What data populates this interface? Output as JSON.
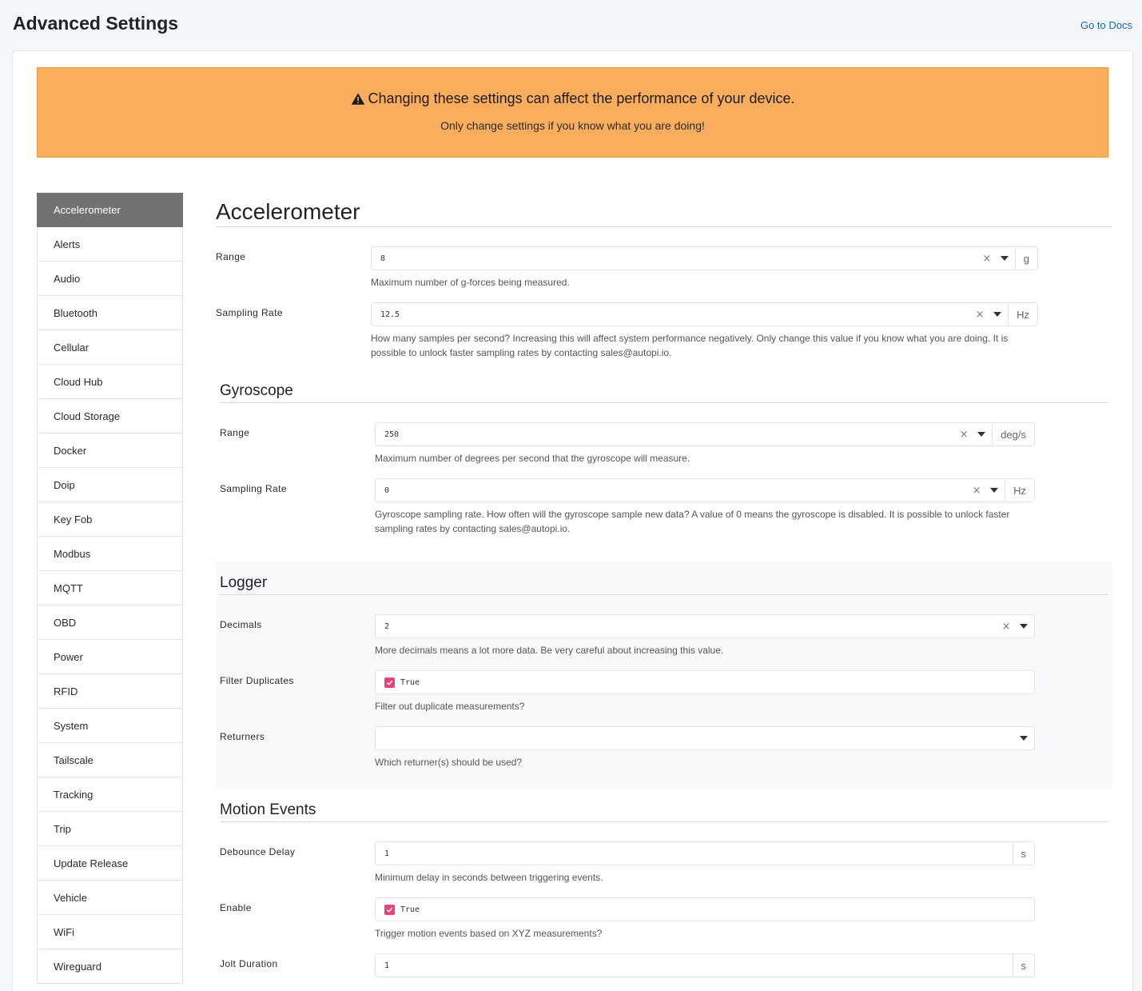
{
  "page": {
    "title": "Advanced Settings",
    "docs_link": "Go to Docs"
  },
  "warning": {
    "title": "Changing these settings can affect the performance of your device.",
    "subtitle": "Only change settings if you know what you are doing!"
  },
  "sidebar": {
    "items": [
      {
        "label": "Accelerometer",
        "active": true
      },
      {
        "label": "Alerts"
      },
      {
        "label": "Audio"
      },
      {
        "label": "Bluetooth"
      },
      {
        "label": "Cellular"
      },
      {
        "label": "Cloud Hub"
      },
      {
        "label": "Cloud Storage"
      },
      {
        "label": "Docker"
      },
      {
        "label": "Doip"
      },
      {
        "label": "Key Fob"
      },
      {
        "label": "Modbus"
      },
      {
        "label": "MQTT"
      },
      {
        "label": "OBD"
      },
      {
        "label": "Power"
      },
      {
        "label": "RFID"
      },
      {
        "label": "System"
      },
      {
        "label": "Tailscale"
      },
      {
        "label": "Tracking"
      },
      {
        "label": "Trip"
      },
      {
        "label": "Update Release"
      },
      {
        "label": "Vehicle"
      },
      {
        "label": "WiFi"
      },
      {
        "label": "Wireguard"
      }
    ]
  },
  "accelerometer": {
    "heading": "Accelerometer",
    "range": {
      "label": "Range",
      "value": "8",
      "unit": "g",
      "help": "Maximum number of g-forces being measured."
    },
    "sampling_rate": {
      "label": "Sampling Rate",
      "value": "12.5",
      "unit": "Hz",
      "help": "How many samples per second? Increasing this will affect system performance negatively. Only change this value if you know what you are doing. It is possible to unlock faster sampling rates by contacting sales@autopi.io."
    }
  },
  "gyroscope": {
    "heading": "Gyroscope",
    "range": {
      "label": "Range",
      "value": "250",
      "unit": "deg/s",
      "help": "Maximum number of degrees per second that the gyroscope will measure."
    },
    "sampling_rate": {
      "label": "Sampling Rate",
      "value": "0",
      "unit": "Hz",
      "help": "Gyroscope sampling rate. How often will the gyroscope sample new data? A value of 0 means the gyroscope is disabled. It is possible to unlock faster sampling rates by contacting sales@autopi.io."
    }
  },
  "logger": {
    "heading": "Logger",
    "decimals": {
      "label": "Decimals",
      "value": "2",
      "help": "More decimals means a lot more data. Be very careful about increasing this value."
    },
    "filter_duplicates": {
      "label": "Filter Duplicates",
      "value": "True",
      "help": "Filter out duplicate measurements?"
    },
    "returners": {
      "label": "Returners",
      "value": "",
      "help": "Which returner(s) should be used?"
    }
  },
  "motion_events": {
    "heading": "Motion Events",
    "debounce_delay": {
      "label": "Debounce Delay",
      "value": "1",
      "unit": "s",
      "help": "Minimum delay in seconds between triggering events."
    },
    "enable": {
      "label": "Enable",
      "value": "True",
      "help": "Trigger motion events based on XYZ measurements?"
    },
    "jolt_duration": {
      "label": "Jolt Duration",
      "value": "1",
      "unit": "s"
    }
  },
  "colors": {
    "warning_bg": "#f9ad5d",
    "active_sidebar": "#707173",
    "checkbox": "#e7437b",
    "link": "#1565c0"
  },
  "icons": {
    "warning": "warning-triangle-icon",
    "clear": "clear-icon",
    "caret": "chevron-down-icon",
    "check": "check-icon"
  }
}
